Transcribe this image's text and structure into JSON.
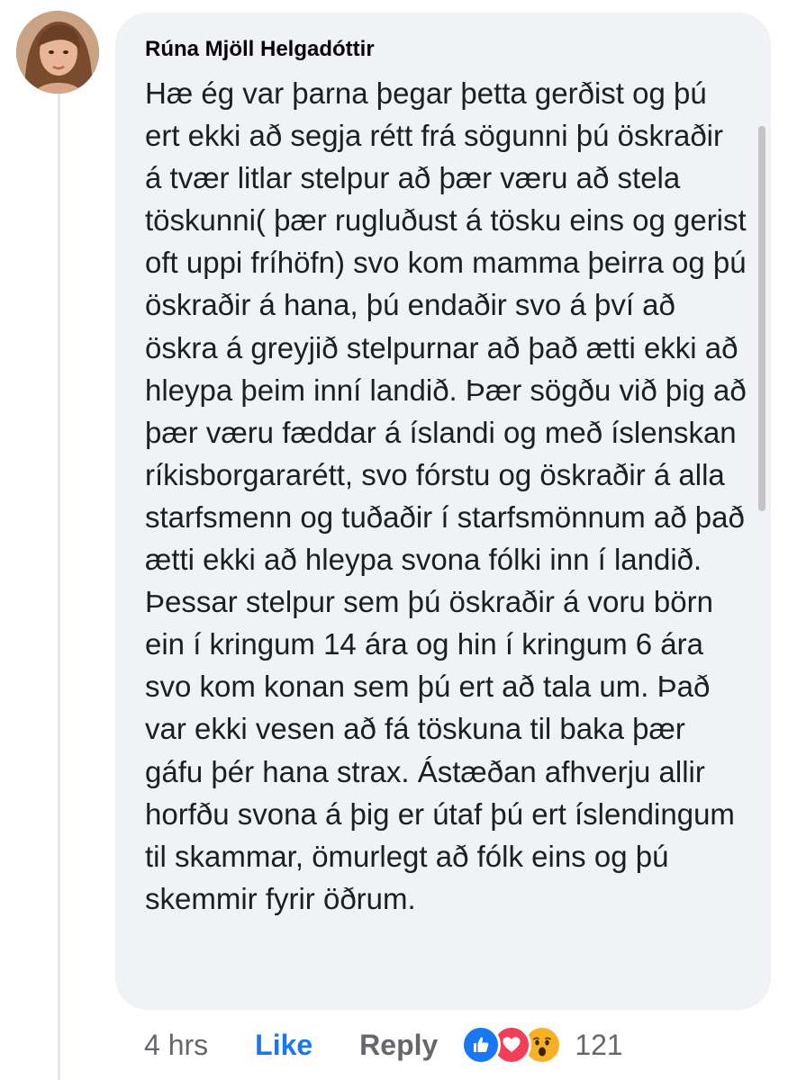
{
  "comment": {
    "author": "Rúna Mjöll Helgadóttir",
    "text": "Hæ ég var þarna þegar þetta gerðist og þú ert ekki að segja rétt frá sögunni þú öskraðir á tvær litlar stelpur að þær væru að stela töskunni( þær rugluðust á tösku eins og gerist oft uppi fríhöfn) svo kom mamma þeirra og þú öskraðir á hana, þú endaðir svo á því að öskra á greyjið stelpurnar að það ætti ekki að hleypa þeim inní landið. Þær sögðu við þig að þær væru fæddar á íslandi og með íslenskan ríkisborgararétt, svo fórstu og öskraðir á alla starfsmenn og tuðaðir í starfsmönnum að það ætti ekki að hleypa svona fólki inn í landið. Þessar stelpur sem þú öskraðir á voru börn ein í kringum 14 ára og hin í kringum 6 ára svo kom konan sem þú ert að tala um. Það var ekki vesen að fá töskuna til baka þær gáfu þér hana strax. Ástæðan afhverju allir horfðu svona á þig er útaf þú ert íslendingum til skammar, ömurlegt að fólk eins og þú skemmir fyrir öðrum.",
    "time": "4 hrs",
    "like_label": "Like",
    "reply_label": "Reply",
    "reaction_count": "121",
    "reaction_icons": [
      "like-reaction-icon",
      "love-reaction-icon",
      "wow-reaction-icon"
    ]
  },
  "colors": {
    "bubble": "#f0f2f5",
    "like_blue": "#1877f2",
    "meta_gray": "#65676b",
    "love_red": "#f33e58",
    "wow_yellow": "#f7b125"
  }
}
